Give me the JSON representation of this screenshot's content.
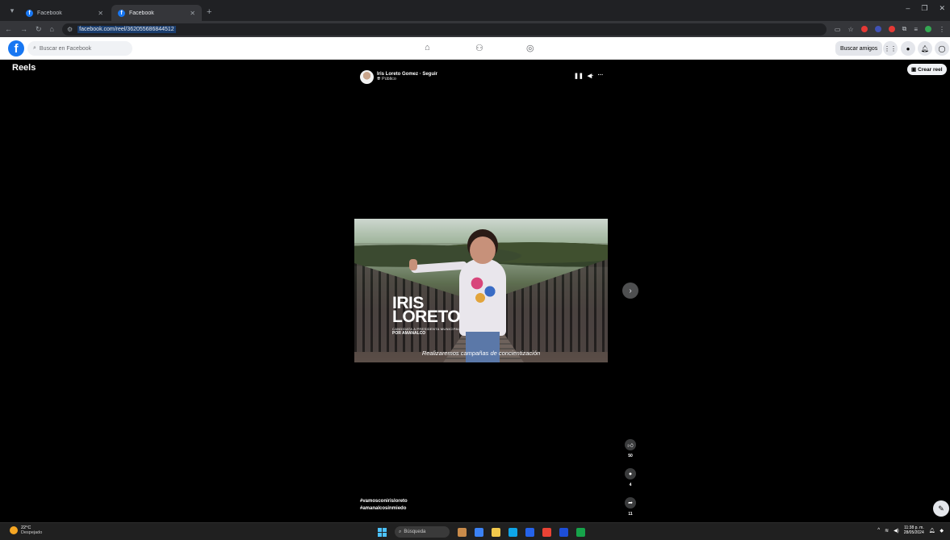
{
  "browser": {
    "tabs": [
      {
        "title": "Facebook",
        "active": false
      },
      {
        "title": "Facebook",
        "active": true
      }
    ],
    "url": "facebook.com/reel/362055686844512"
  },
  "fb": {
    "search_placeholder": "Buscar en Facebook",
    "find_friends": "Buscar amigos"
  },
  "reels": {
    "title": "Reels",
    "create_label": "Crear reel",
    "author": "Iris Loreto Gomez · Seguir",
    "visibility": "Público",
    "video": {
      "overlay_name": "IRIS\nLORETO",
      "overlay_small": "CANDIDATA A PRESIDENTA MUNICIPAL",
      "overlay_por": "POR AMANALCO",
      "caption": "Realizaremos campañas de concientización"
    },
    "likes": "50",
    "comments": "4",
    "shares": "11",
    "hashtags": [
      "#vamosconirisloreto",
      "#amanalcosinmiedo"
    ]
  },
  "taskbar": {
    "temp": "22°C",
    "weather": "Despejado",
    "search_label": "Búsqueda",
    "time": "11:38 p. m.",
    "date": "28/05/2024"
  },
  "colors": {
    "fb_blue": "#1877f2",
    "background": "#000000"
  }
}
